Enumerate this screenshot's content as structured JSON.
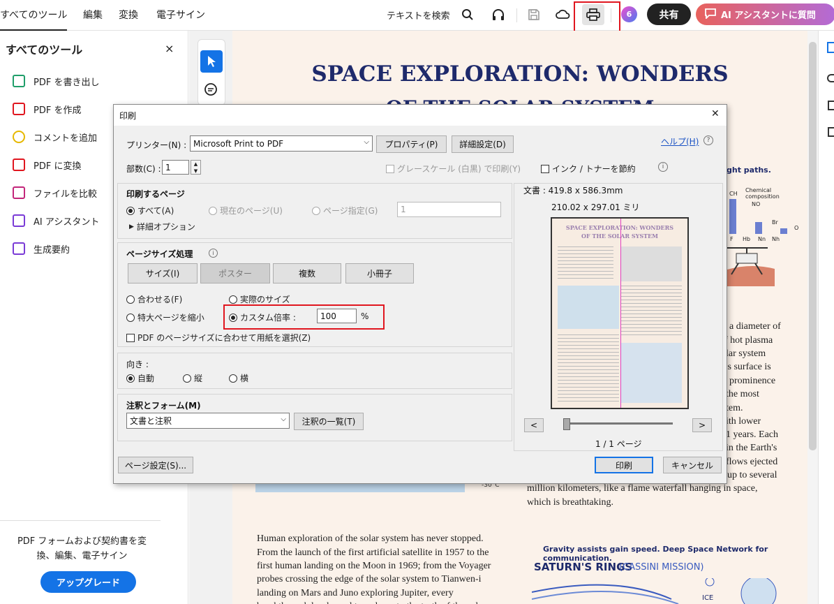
{
  "topbar": {
    "menus": [
      "すべてのツール",
      "編集",
      "変換",
      "電子サイン"
    ],
    "search_text": "テキストを検索",
    "share_label": "共有",
    "ai_label": "AI アシスタントに質問",
    "avatar_text": "6",
    "icons": [
      "search-icon",
      "headphones-icon",
      "save-icon",
      "cloud-icon",
      "print-icon",
      "avatar-icon",
      "ai-chat-icon"
    ]
  },
  "leftpanel": {
    "title": "すべてのツール",
    "close": "×",
    "items": [
      {
        "label": "PDF を書き出し",
        "color": "#1f9e6a"
      },
      {
        "label": "PDF を作成",
        "color": "#e0161f"
      },
      {
        "label": "コメントを追加",
        "color": "#e6b800"
      },
      {
        "label": "PDF に変換",
        "color": "#e0161f"
      },
      {
        "label": "ファイルを比較",
        "color": "#c3267a"
      },
      {
        "label": "AI アシスタント",
        "color": "#7a3bd6"
      },
      {
        "label": "生成要約",
        "color": "#7a3bd6"
      }
    ],
    "upgrade_text": "PDF フォームおよび契約書を変換、編集、電子サイン",
    "upgrade_button": "アップグレード"
  },
  "document": {
    "title_line1": "SPACE EXPLORATION: WONDERS",
    "title_line2": "OF THE SOLAR SYSTEM",
    "fragment_flight": "ght paths.",
    "chart_label_ch": "CH",
    "chart_label_chemical": "Chemical",
    "chart_label_composition": "composition",
    "chart_label_no": "NO",
    "chart_label_br": "Br",
    "chart_label_o": "O",
    "chart_axis": [
      "F",
      "Hb",
      "Nn",
      "Nh"
    ],
    "right_col_lines": [
      "a diameter of",
      "f hot plasma",
      "lar system",
      "'s surface is",
      "prominence",
      "the most",
      "tem.",
      "ith lower",
      "1 years. Each",
      "in the Earth's",
      "flows ejected",
      "up to several",
      "million kilometers, like a flame waterfall hanging in space,",
      "which is breathtaking."
    ],
    "temp_label": "-30°C",
    "left_para": [
      "Human exploration of the solar system has never stopped.",
      "From the launch of the first artificial satellite in 1957 to the",
      "first human landing on the Moon in 1969; from the Voyager",
      "probes crossing the edge of the solar system to Tianwen-i",
      "landing on Mars and Juno exploring Jupiter, every",
      "breakthrough has brought us closer to the truth of the solar"
    ],
    "gravity_caption": "Gravity assists gain speed. Deep Space Network for communication.",
    "saturn_heading": "SATURN'S RINGS",
    "saturn_sub": "(CASSINI MISSION)",
    "ice_label": "ICE"
  },
  "dialog": {
    "title": "印刷",
    "close": "✕",
    "printer_label": "プリンター(N) :",
    "printer_value": "Microsoft Print to PDF",
    "properties_button": "プロパティ(P)",
    "advanced_button": "詳細設定(D)",
    "help_link": "ヘルプ(H)",
    "copies_label": "部数(C) :",
    "copies_value": "1",
    "grayscale_label": "グレースケール (白黒) で印刷(Y)",
    "ink_label": "インク / トナーを節約",
    "pages_heading": "印刷するページ",
    "pages_all": "すべて(A)",
    "pages_current": "現在のページ(U)",
    "pages_range": "ページ指定(G)",
    "pages_range_value": "1",
    "more_options": "詳細オプション",
    "size_heading": "ページサイズ処理",
    "size_tabs": [
      "サイズ(I)",
      "ポスター",
      "複数",
      "小冊子"
    ],
    "fit": "合わせる(F)",
    "actual_size": "実際のサイズ",
    "shrink": "特大ページを縮小",
    "custom_scale": "カスタム倍率 :",
    "custom_scale_value": "100",
    "percent": "%",
    "choose_paper": "PDF のページサイズに合わせて用紙を選択(Z)",
    "orientation_heading": "向き :",
    "orient_auto": "自動",
    "orient_portrait": "縦",
    "orient_landscape": "横",
    "comments_heading": "注釈とフォーム(M)",
    "comments_value": "文書と注釈",
    "comments_list_button": "注釈の一覧(T)",
    "doc_size": "文書 : 419.8 x 586.3mm",
    "paper_size": "210.02 x 297.01 ミリ",
    "preview_title_1": "SPACE EXPLORATION: WONDERS",
    "preview_title_2": "OF THE SOLAR SYSTEM",
    "prev_button": "<",
    "next_button": ">",
    "page_indicator": "1 / 1 ページ",
    "page_setup_button": "ページ設定(S)...",
    "print_button": "印刷",
    "cancel_button": "キャンセル"
  },
  "colors": {
    "accent": "#1473e6",
    "highlight": "#e0161f",
    "title": "#1e2a6b"
  }
}
